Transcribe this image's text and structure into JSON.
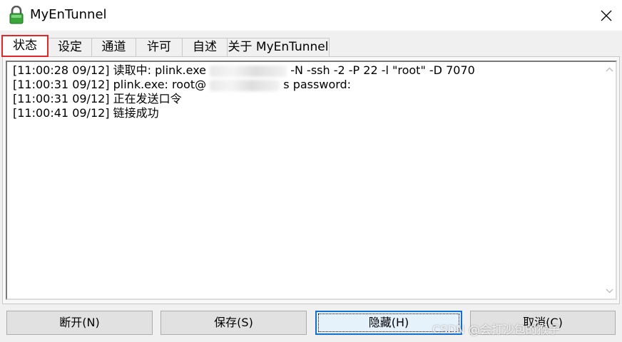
{
  "window": {
    "title": "MyEnTunnel",
    "icon": "lock-icon",
    "close_icon": "close-icon"
  },
  "tabs": [
    {
      "label": "状态",
      "active": true
    },
    {
      "label": "设定",
      "active": false
    },
    {
      "label": "通道",
      "active": false
    },
    {
      "label": "许可",
      "active": false
    },
    {
      "label": "自述",
      "active": false
    },
    {
      "label": "关于 MyEnTunnel",
      "active": false
    }
  ],
  "log": {
    "lines": [
      {
        "prefix": "[11:00:28 09/12] 读取中: plink.exe",
        "suffix": "-N -ssh -2 -P 22 -l \"root\" -D 7070"
      },
      {
        "prefix": "[11:00:31 09/12] plink.exe: root@",
        "suffix": "s password:"
      },
      {
        "prefix": "[11:00:31 09/12] 正在发送口令",
        "suffix": ""
      },
      {
        "prefix": "[11:00:41 09/12] 链接成功",
        "suffix": ""
      }
    ]
  },
  "buttons": {
    "disconnect": "断开(N)",
    "save": "保存(S)",
    "hide": "隐藏(H)",
    "cancel": "取消(C)"
  },
  "watermark": "CSDN @会打沙包的猴子",
  "colors": {
    "tab_highlight": "#e0282a",
    "focus_border": "#1070d4"
  }
}
